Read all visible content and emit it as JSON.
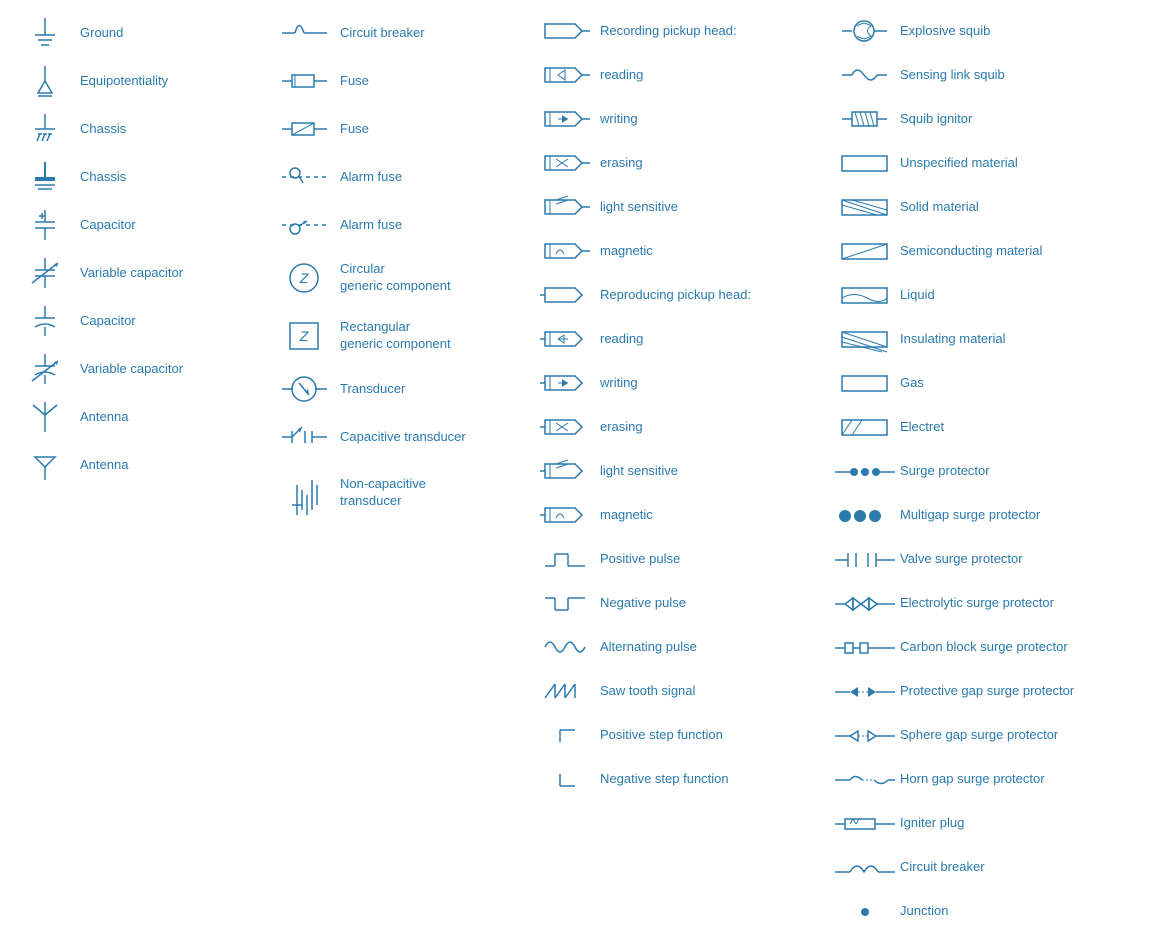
{
  "col1": [
    {
      "label": "Ground",
      "symbol": "ground"
    },
    {
      "label": "Equipotentiality",
      "symbol": "equipotentiality"
    },
    {
      "label": "Chassis",
      "symbol": "chassis1"
    },
    {
      "label": "Chassis",
      "symbol": "chassis2"
    },
    {
      "label": "Capacitor",
      "symbol": "capacitor"
    },
    {
      "label": "Variable capacitor",
      "symbol": "variable_capacitor"
    },
    {
      "label": "Capacitor",
      "symbol": "capacitor2"
    },
    {
      "label": "Variable capacitor",
      "symbol": "variable_capacitor2"
    },
    {
      "label": "Antenna",
      "symbol": "antenna1"
    },
    {
      "label": "Antenna",
      "symbol": "antenna2"
    }
  ],
  "col2": [
    {
      "label": "Circuit breaker",
      "symbol": "circuit_breaker"
    },
    {
      "label": "Fuse",
      "symbol": "fuse1"
    },
    {
      "label": "Fuse",
      "symbol": "fuse2"
    },
    {
      "label": "Alarm fuse",
      "symbol": "alarm_fuse1"
    },
    {
      "label": "Alarm fuse",
      "symbol": "alarm_fuse2"
    },
    {
      "label": "Circular\ngeneric component",
      "symbol": "circular_generic"
    },
    {
      "label": "Rectangular\ngeneric component",
      "symbol": "rectangular_generic"
    },
    {
      "label": "Transducer",
      "symbol": "transducer"
    },
    {
      "label": "Capacitive transducer",
      "symbol": "capacitive_transducer"
    },
    {
      "label": "Non-capacitive\ntransducer",
      "symbol": "non_capacitive_transducer"
    }
  ],
  "col3": [
    {
      "label": "Recording pickup head:",
      "symbol": "recording_head"
    },
    {
      "label": "reading",
      "symbol": "reading1"
    },
    {
      "label": "writing",
      "symbol": "writing1"
    },
    {
      "label": "erasing",
      "symbol": "erasing1"
    },
    {
      "label": "light sensitive",
      "symbol": "light_sensitive1"
    },
    {
      "label": "magnetic",
      "symbol": "magnetic1"
    },
    {
      "label": "Reproducing pickup head:",
      "symbol": "reproducing_head"
    },
    {
      "label": "reading",
      "symbol": "reading2"
    },
    {
      "label": "writing",
      "symbol": "writing2"
    },
    {
      "label": "erasing",
      "symbol": "erasing2"
    },
    {
      "label": "light sensitive",
      "symbol": "light_sensitive2"
    },
    {
      "label": "magnetic",
      "symbol": "magnetic2"
    },
    {
      "label": "Positive pulse",
      "symbol": "positive_pulse"
    },
    {
      "label": "Negative pulse",
      "symbol": "negative_pulse"
    },
    {
      "label": "Alternating pulse",
      "symbol": "alternating_pulse"
    },
    {
      "label": "Saw tooth signal",
      "symbol": "saw_tooth"
    },
    {
      "label": "Positive step function",
      "symbol": "positive_step"
    },
    {
      "label": "Negative step function",
      "symbol": "negative_step"
    }
  ],
  "col4": [
    {
      "label": "Explosive squib",
      "symbol": "explosive_squib"
    },
    {
      "label": "Sensing link squib",
      "symbol": "sensing_link_squib"
    },
    {
      "label": "Squib ignitor",
      "symbol": "squib_ignitor"
    },
    {
      "label": "Unspecified material",
      "symbol": "unspecified_material"
    },
    {
      "label": "Solid material",
      "symbol": "solid_material"
    },
    {
      "label": "Semiconducting material",
      "symbol": "semiconducting_material"
    },
    {
      "label": "Liquid",
      "symbol": "liquid"
    },
    {
      "label": "Insulating material",
      "symbol": "insulating_material"
    },
    {
      "label": "Gas",
      "symbol": "gas"
    },
    {
      "label": "Electret",
      "symbol": "electret"
    },
    {
      "label": "Surge protector",
      "symbol": "surge_protector"
    },
    {
      "label": "Multigap surge protector",
      "symbol": "multigap_surge_protector"
    },
    {
      "label": "Valve surge protector",
      "symbol": "valve_surge_protector"
    },
    {
      "label": "Electrolytic surge protector",
      "symbol": "electrolytic_surge_protector"
    },
    {
      "label": "Carbon block surge protector",
      "symbol": "carbon_block_surge_protector"
    },
    {
      "label": "Protective gap surge protector",
      "symbol": "protective_gap_surge_protector"
    },
    {
      "label": "Sphere gap surge protector",
      "symbol": "sphere_gap_surge_protector"
    },
    {
      "label": "Horn gap surge protector",
      "symbol": "horn_gap_surge_protector"
    },
    {
      "label": "Igniter plug",
      "symbol": "igniter_plug"
    },
    {
      "label": "Circuit breaker",
      "symbol": "circuit_breaker2"
    },
    {
      "label": "Junction",
      "symbol": "junction"
    }
  ]
}
